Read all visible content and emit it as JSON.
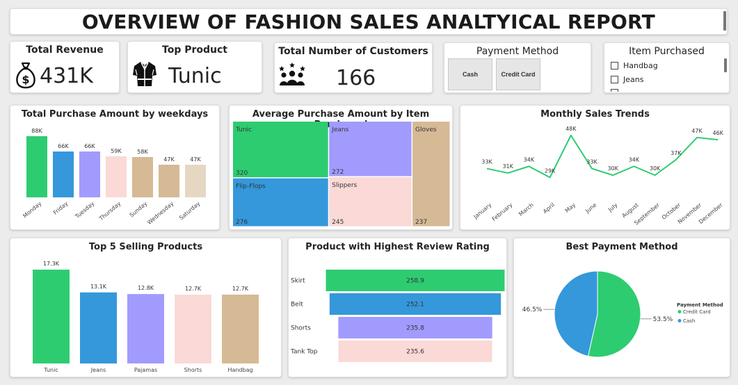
{
  "report_title": "OVERVIEW OF FASHION SALES ANALTYICAL REPORT",
  "kpis": {
    "revenue": {
      "title": "Total Revenue",
      "value": "431K",
      "icon": "money-bag-icon"
    },
    "top_product": {
      "title": "Top Product",
      "value": "Tunic",
      "icon": "tunic-icon"
    },
    "customers": {
      "title": "Total Number of Customers",
      "value": "166",
      "icon": "people-icon"
    }
  },
  "payment_slicer": {
    "title": "Payment Method",
    "options": [
      "Cash",
      "Credit Card"
    ]
  },
  "item_slicer": {
    "title": "Item Purchased",
    "options": [
      "Handbag",
      "Jeans"
    ]
  },
  "colors": {
    "green": "#2ECC71",
    "blue": "#3498DB",
    "purple": "#A29BFE",
    "pink": "#FAD9D7",
    "tan": "#D6B995",
    "tan_light": "#E6D7C3",
    "line": "#2ECC71"
  },
  "chart_data": [
    {
      "id": "weekday",
      "type": "bar",
      "title": "Total Purchase Amount by weekdays",
      "categories": [
        "Monday",
        "Friday",
        "Tuesday",
        "Thursday",
        "Sunday",
        "Wednesday",
        "Saturday"
      ],
      "values": [
        88,
        66,
        66,
        59,
        58,
        47,
        47
      ],
      "labels": [
        "88K",
        "66K",
        "66K",
        "59K",
        "58K",
        "47K",
        "47K"
      ],
      "colors": [
        "#2ECC71",
        "#3498DB",
        "#A29BFE",
        "#FAD9D7",
        "#D6B995",
        "#D6B995",
        "#E6D7C3"
      ],
      "ylim": [
        0,
        100
      ]
    },
    {
      "id": "treemap",
      "type": "treemap",
      "title": "Average Purchase Amount by Item Purchased",
      "items": [
        {
          "name": "Tunic",
          "value": 320,
          "label": "320",
          "color": "#2ECC71"
        },
        {
          "name": "Jeans",
          "value": 272,
          "label": "272",
          "color": "#A29BFE"
        },
        {
          "name": "Gloves",
          "value": 237,
          "label": "237",
          "color": "#D6B995"
        },
        {
          "name": "Flip-Flops",
          "value": 276,
          "label": "276",
          "color": "#3498DB"
        },
        {
          "name": "Slippers",
          "value": 245,
          "label": "245",
          "color": "#FAD9D7"
        }
      ]
    },
    {
      "id": "monthly",
      "type": "line",
      "title": "Monthly Sales Trends",
      "categories": [
        "January",
        "February",
        "March",
        "April",
        "May",
        "June",
        "July",
        "August",
        "September",
        "October",
        "November",
        "December"
      ],
      "values": [
        33,
        31,
        34,
        29,
        48,
        33,
        30,
        34,
        30,
        37,
        47,
        46
      ],
      "labels": [
        "33K",
        "31K",
        "34K",
        "29K",
        "48K",
        "33K",
        "30K",
        "34K",
        "30K",
        "37K",
        "47K",
        "46K"
      ],
      "ylim": [
        20,
        52
      ]
    },
    {
      "id": "top5",
      "type": "bar",
      "title": "Top 5 Selling Products",
      "categories": [
        "Tunic",
        "Jeans",
        "Pajamas",
        "Shorts",
        "Handbag"
      ],
      "values": [
        17.3,
        13.1,
        12.8,
        12.7,
        12.7
      ],
      "labels": [
        "17.3K",
        "13.1K",
        "12.8K",
        "12.7K",
        "12.7K"
      ],
      "colors": [
        "#2ECC71",
        "#3498DB",
        "#A29BFE",
        "#FAD9D7",
        "#D6B995"
      ],
      "ylim": [
        0,
        17.3
      ]
    },
    {
      "id": "review",
      "type": "funnel",
      "title": "Product with Highest Review Rating",
      "categories": [
        "Skirt",
        "Belt",
        "Shorts",
        "Tank Top"
      ],
      "values": [
        258.9,
        252.1,
        235.8,
        235.6
      ],
      "labels": [
        "258.9",
        "252.1",
        "235.8",
        "235.6"
      ],
      "colors": [
        "#2ECC71",
        "#3498DB",
        "#A29BFE",
        "#FAD9D7"
      ]
    },
    {
      "id": "payment",
      "type": "pie",
      "title": "Best Payment Method",
      "legend_title": "Payment Method",
      "slices": [
        {
          "name": "Credit Card",
          "value": 53.5,
          "label": "53.5%",
          "color": "#2ECC71"
        },
        {
          "name": "Cash",
          "value": 46.5,
          "label": "46.5%",
          "color": "#3498DB"
        }
      ]
    }
  ]
}
